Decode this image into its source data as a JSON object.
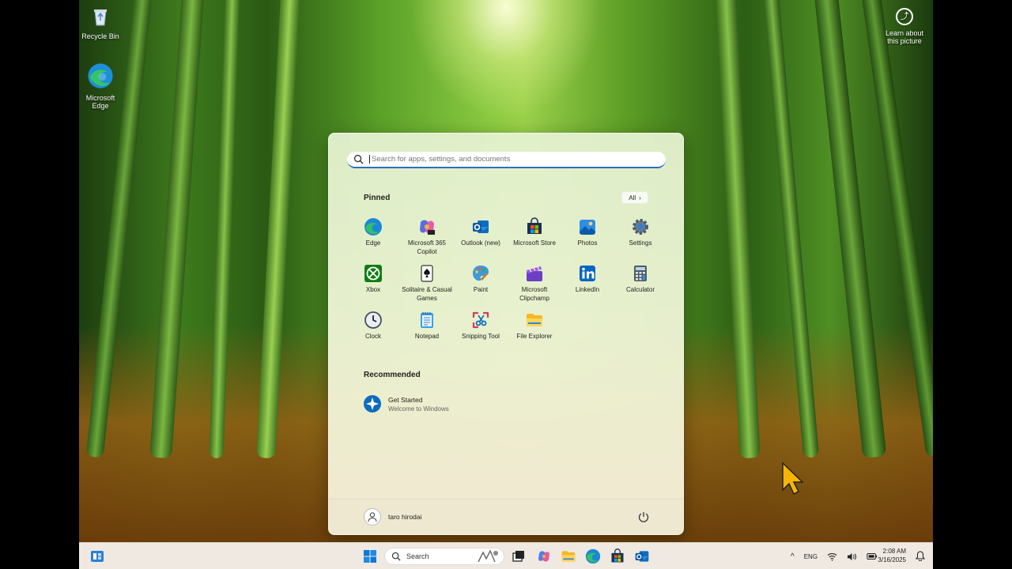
{
  "desktop": {
    "icons": [
      {
        "label": "Recycle Bin",
        "icon": "recycle-bin-icon"
      },
      {
        "label": "Microsoft Edge",
        "icon": "edge-icon"
      }
    ],
    "learn_label": "Learn about this picture"
  },
  "start_menu": {
    "search_placeholder": "Search for apps, settings, and documents",
    "pinned_title": "Pinned",
    "all_label": "All",
    "pinned_apps": [
      {
        "label": "Edge",
        "icon": "edge-icon"
      },
      {
        "label": "Microsoft 365 Copilot",
        "icon": "m365-copilot-icon"
      },
      {
        "label": "Outlook (new)",
        "icon": "outlook-icon"
      },
      {
        "label": "Microsoft Store",
        "icon": "store-icon"
      },
      {
        "label": "Photos",
        "icon": "photos-icon"
      },
      {
        "label": "Settings",
        "icon": "settings-icon"
      },
      {
        "label": "Xbox",
        "icon": "xbox-icon"
      },
      {
        "label": "Solitaire & Casual Games",
        "icon": "solitaire-icon"
      },
      {
        "label": "Paint",
        "icon": "paint-icon"
      },
      {
        "label": "Microsoft Clipchamp",
        "icon": "clipchamp-icon"
      },
      {
        "label": "LinkedIn",
        "icon": "linkedin-icon"
      },
      {
        "label": "Calculator",
        "icon": "calculator-icon"
      },
      {
        "label": "Clock",
        "icon": "clock-icon"
      },
      {
        "label": "Notepad",
        "icon": "notepad-icon"
      },
      {
        "label": "Snipping Tool",
        "icon": "snipping-tool-icon"
      },
      {
        "label": "File Explorer",
        "icon": "file-explorer-icon"
      }
    ],
    "recommended_title": "Recommended",
    "recommended": [
      {
        "title": "Get Started",
        "subtitle": "Welcome to Windows",
        "icon": "get-started-icon"
      }
    ],
    "user_name": "taro hirodai"
  },
  "taskbar": {
    "search_label": "Search",
    "language": "ENG",
    "time": "2:08 AM",
    "date": "3/16/2025"
  }
}
